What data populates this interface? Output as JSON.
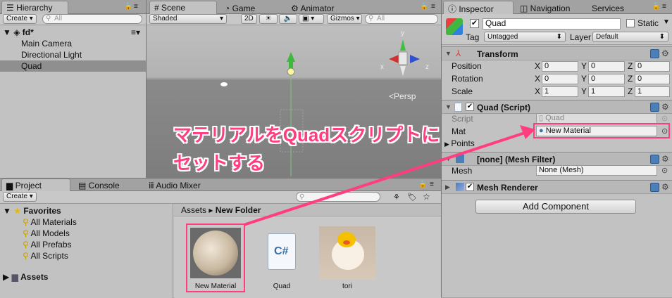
{
  "hierarchy": {
    "tab": "Hierarchy",
    "create": "Create",
    "search_placeholder": "All",
    "scene_name": "fd*",
    "items": [
      "Main Camera",
      "Directional Light",
      "Quad"
    ]
  },
  "scene": {
    "tabs": [
      "Scene",
      "Game",
      "Animator"
    ],
    "shading": "Shaded",
    "mode2d": "2D",
    "gizmos": "Gizmos",
    "search_placeholder": "All",
    "persp": "Persp",
    "axis_y": "y",
    "axis_x": "x",
    "axis_z": "z"
  },
  "project": {
    "tabs": [
      "Project",
      "Console",
      "Audio Mixer"
    ],
    "create": "Create",
    "favorites": "Favorites",
    "fav_items": [
      "All Materials",
      "All Models",
      "All Prefabs",
      "All Scripts"
    ],
    "assets": "Assets",
    "breadcrumb_root": "Assets",
    "breadcrumb_sep": "▸",
    "breadcrumb_current": "New Folder",
    "files": [
      "New Material",
      "Quad",
      "tori"
    ],
    "cs_label": "C#"
  },
  "inspector": {
    "tabs": [
      "Inspector",
      "Navigation",
      "Services"
    ],
    "object_name": "Quad",
    "static_label": "Static",
    "tag_label": "Tag",
    "tag_value": "Untagged",
    "layer_label": "Layer",
    "layer_value": "Default",
    "transform": {
      "title": "Transform",
      "rows": [
        {
          "label": "Position",
          "x": "0",
          "y": "0",
          "z": "0"
        },
        {
          "label": "Rotation",
          "x": "0",
          "y": "0",
          "z": "0"
        },
        {
          "label": "Scale",
          "x": "1",
          "y": "1",
          "z": "1"
        }
      ],
      "axis_labels": [
        "X",
        "Y",
        "Z"
      ]
    },
    "quad_script": {
      "title": "Quad (Script)",
      "script_label": "Script",
      "script_value": "Quad",
      "mat_label": "Mat",
      "mat_value": "New Material",
      "points_label": "Points"
    },
    "mesh_filter": {
      "title": "[none] (Mesh Filter)",
      "mesh_label": "Mesh",
      "mesh_value": "None (Mesh)"
    },
    "mesh_renderer": {
      "title": "Mesh Renderer"
    },
    "add_component": "Add Component"
  },
  "annotation": {
    "line1": "マテリアルをQuadスクリプトに",
    "line2": "セットする",
    "color": "#ff3d7f"
  }
}
